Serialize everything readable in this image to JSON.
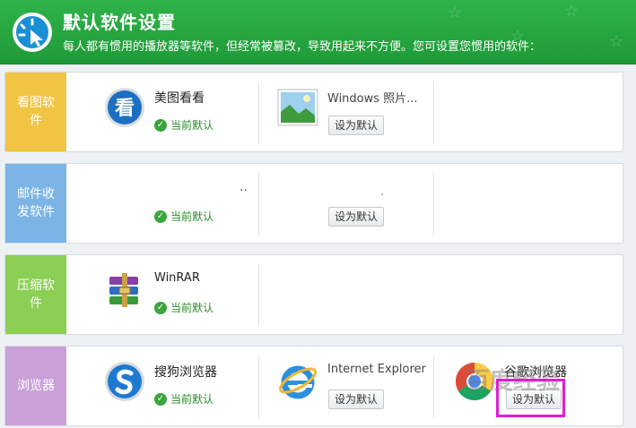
{
  "header": {
    "title": "默认软件设置",
    "subtitle": "每人都有惯用的播放器等软件，但经常被篡改，导致用起来不方便。您可设置您惯用的软件："
  },
  "current_default_label": "当前默认",
  "set_default_label": "设为默认",
  "rows": [
    {
      "label": "看图软件",
      "color": "#f2c443",
      "apps": [
        {
          "name": "美图看看",
          "icon": "meitu-kankan-icon",
          "status": "当前默认"
        },
        {
          "name": "Windows 照片...",
          "icon": "windows-photo-icon",
          "button": "设为默认"
        }
      ]
    },
    {
      "label": "邮件收发软件",
      "color": "#7cb4e6",
      "apps": [
        {
          "name": "..",
          "icon": "",
          "status": "当前默认"
        },
        {
          "name": ".",
          "icon": "",
          "button": "设为默认"
        }
      ]
    },
    {
      "label": "压缩软件",
      "color": "#8ccf55",
      "apps": [
        {
          "name": "WinRAR",
          "icon": "winrar-icon",
          "status": "当前默认"
        }
      ]
    },
    {
      "label": "浏览器",
      "color": "#c9a0d8",
      "apps": [
        {
          "name": "搜狗浏览器",
          "icon": "sogou-browser-icon",
          "status": "当前默认"
        },
        {
          "name": "Internet Explorer",
          "icon": "ie-icon",
          "button": "设为默认"
        },
        {
          "name": "谷歌浏览器",
          "icon": "chrome-icon",
          "button": "设为默认"
        }
      ]
    }
  ],
  "watermark": "百度经验"
}
